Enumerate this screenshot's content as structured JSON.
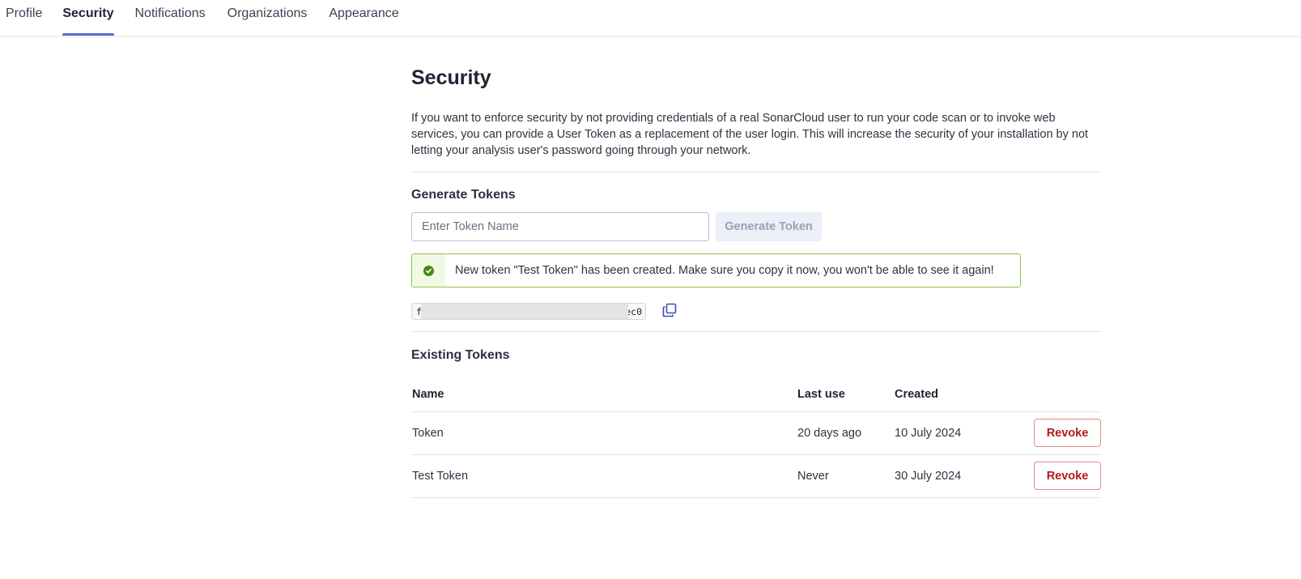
{
  "nav": {
    "tabs": [
      {
        "label": "Profile"
      },
      {
        "label": "Security"
      },
      {
        "label": "Notifications"
      },
      {
        "label": "Organizations"
      },
      {
        "label": "Appearance"
      }
    ],
    "active_tab": "Security"
  },
  "page": {
    "title": "Security",
    "intro": "If you want to enforce security by not providing credentials of a real SonarCloud user to run your code scan or to invoke web services, you can provide a User Token as a replacement of the user login. This will increase the security of your installation by not letting your analysis user's password going through your network."
  },
  "generate": {
    "heading": "Generate Tokens",
    "input_value": "",
    "input_placeholder": "Enter Token Name",
    "button_label": "Generate Token"
  },
  "alert": {
    "message": "New token \"Test Token\" has been created. Make sure you copy it now, you won't be able to see it again!",
    "icon": "check-circle-icon"
  },
  "new_token": {
    "prefix": "f",
    "suffix": "ec0",
    "copy_icon": "copy-icon"
  },
  "existing": {
    "heading": "Existing Tokens",
    "columns": [
      "Name",
      "Last use",
      "Created",
      ""
    ],
    "rows": [
      {
        "name": "Token",
        "last_use": "20 days ago",
        "created": "10 July 2024",
        "action": "Revoke"
      },
      {
        "name": "Test Token",
        "last_use": "Never",
        "created": "30 July 2024",
        "action": "Revoke"
      }
    ]
  },
  "colors": {
    "accent": "#5d6cd0",
    "success_border": "#8fc34a",
    "danger": "#b51919"
  }
}
